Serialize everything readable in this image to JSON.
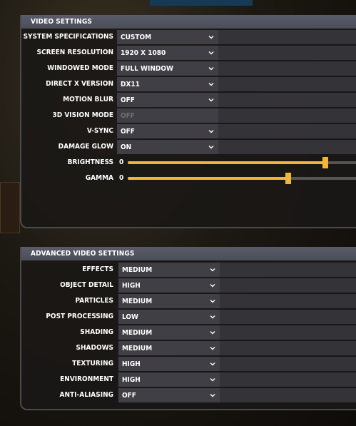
{
  "video_settings": {
    "header": "VIDEO SETTINGS",
    "rows": [
      {
        "label": "SYSTEM SPECIFICATIONS",
        "value": "CUSTOM",
        "disabled": false
      },
      {
        "label": "SCREEN RESOLUTION",
        "value": "1920 X 1080",
        "disabled": false
      },
      {
        "label": "WINDOWED MODE",
        "value": "FULL WINDOW",
        "disabled": false
      },
      {
        "label": "DIRECT X VERSION",
        "value": "DX11",
        "disabled": false
      },
      {
        "label": "MOTION BLUR",
        "value": "OFF",
        "disabled": false
      },
      {
        "label": "3D VISION MODE",
        "value": "OFF",
        "disabled": true
      },
      {
        "label": "V-SYNC",
        "value": "OFF",
        "disabled": false
      },
      {
        "label": "DAMAGE GLOW",
        "value": "ON",
        "disabled": false
      }
    ],
    "sliders": [
      {
        "label": "BRIGHTNESS",
        "value": "0",
        "level": 0.86
      },
      {
        "label": "GAMMA",
        "value": "0",
        "level": 0.7
      }
    ]
  },
  "advanced_video_settings": {
    "header": "ADVANCED VIDEO SETTINGS",
    "rows": [
      {
        "label": "EFFECTS",
        "value": "MEDIUM"
      },
      {
        "label": "OBJECT DETAIL",
        "value": "HIGH"
      },
      {
        "label": "PARTICLES",
        "value": "MEDIUM"
      },
      {
        "label": "POST PROCESSING",
        "value": "LOW"
      },
      {
        "label": "SHADING",
        "value": "MEDIUM"
      },
      {
        "label": "SHADOWS",
        "value": "MEDIUM"
      },
      {
        "label": "TEXTURING",
        "value": "HIGH"
      },
      {
        "label": "ENVIRONMENT",
        "value": "HIGH"
      },
      {
        "label": "ANTI-ALIASING",
        "value": "OFF"
      }
    ]
  },
  "colors": {
    "accent": "#f2b534",
    "header_bg": "#55575f",
    "dropdown_bg": "#3f3f45"
  }
}
